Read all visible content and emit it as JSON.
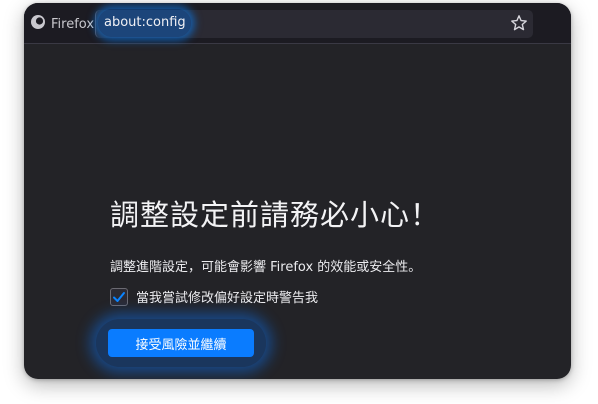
{
  "toolbar": {
    "brand_label": "Firefox",
    "url": "about:config"
  },
  "icons": {
    "brand": "firefox-logo-icon",
    "bookmark": "star-icon",
    "check": "check-icon"
  },
  "warning": {
    "heading": "調整設定前請務必小心！",
    "description": "調整進階設定，可能會影響 Firefox 的效能或安全性。",
    "checkbox_label": "當我嘗試修改偏好設定時警告我",
    "checkbox_checked": true,
    "accept_button": "接受風險並繼續"
  },
  "colors": {
    "accent": "#0a7cff",
    "background": "#232327"
  }
}
